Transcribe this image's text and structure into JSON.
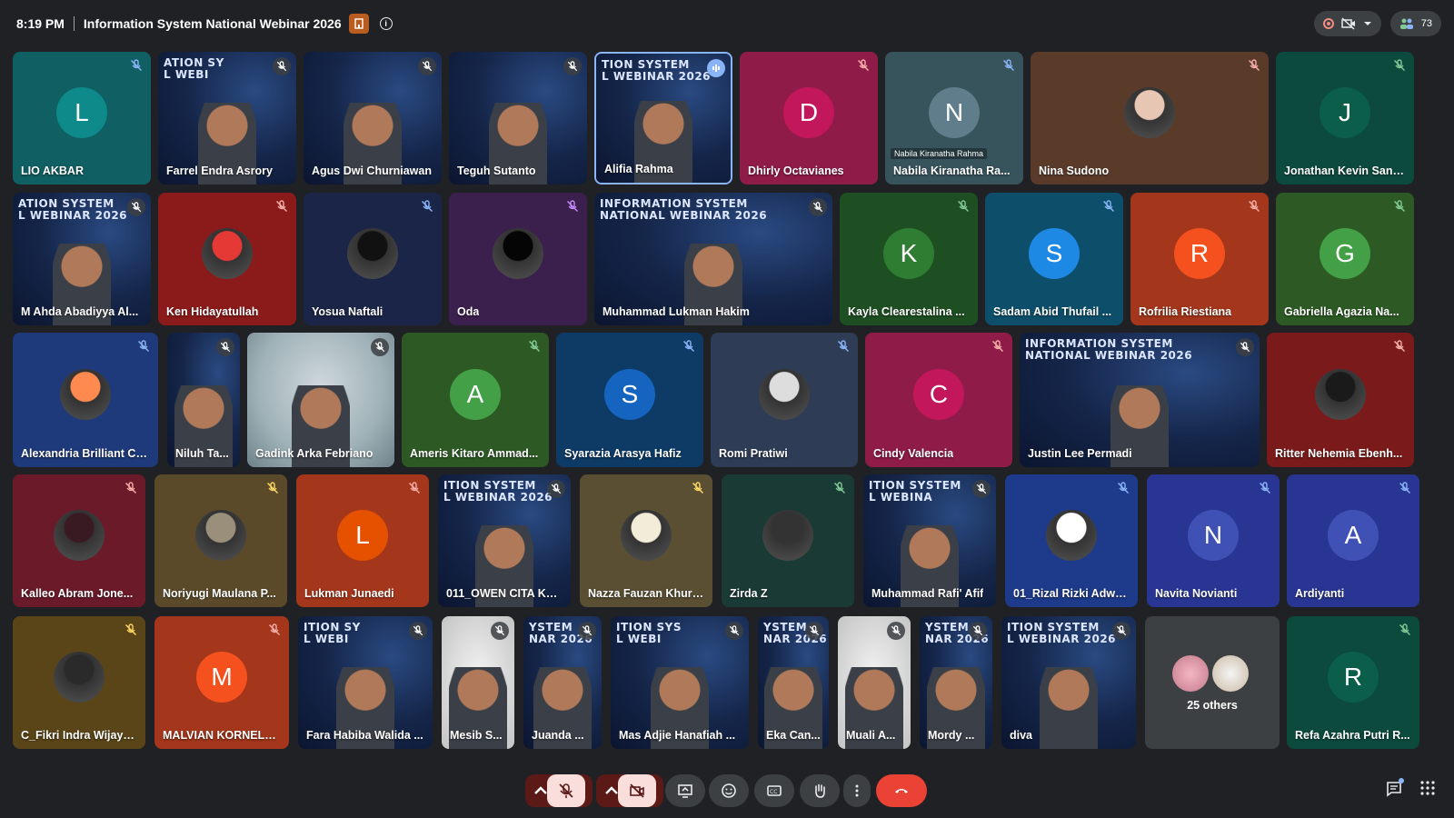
{
  "topbar": {
    "time": "8:19 PM",
    "title": "Information System National Webinar 2026",
    "participant_count": "73"
  },
  "colors": {
    "background": "#202124",
    "control_bg": "#3c4043",
    "end_call": "#ea4335",
    "speaking_border": "#8ab4f8"
  },
  "tiles": [
    {
      "name": "LIO AKBAR",
      "type": "avatar",
      "initial": "L",
      "avatar_color": "#0e8a8a",
      "bg": "#0f5f63",
      "mute": "muted",
      "mute_color": "#8ab4f8"
    },
    {
      "name": "Farrel Endra Asrory",
      "type": "video",
      "banner": "ATION SY\nL WEBI",
      "mute": "muted"
    },
    {
      "name": "Agus Dwi Churniawan",
      "type": "video",
      "banner": "",
      "mute": "muted"
    },
    {
      "name": "Teguh Sutanto",
      "type": "video",
      "banner": "",
      "mute": "muted"
    },
    {
      "name": "Alifia Rahma",
      "type": "video",
      "banner": "TION SYSTEM\nL WEBINAR 2026",
      "speaking": true,
      "mute": "speaking"
    },
    {
      "name": "Dhirly Octavianes",
      "type": "avatar",
      "initial": "D",
      "avatar_color": "#c2185b",
      "bg": "#8f1b48",
      "mute": "muted",
      "mute_color": "#f6aea9"
    },
    {
      "name": "Nabila Kiranatha Ra...",
      "type": "avatar",
      "initial": "N",
      "avatar_color": "#607d8b",
      "bg": "#37535c",
      "mute": "muted",
      "mute_color": "#8ab4f8",
      "sub": "Nabila Kiranatha Rahma"
    },
    {
      "name": "Nina Sudono",
      "type": "photo",
      "bg": "#5a3b2a",
      "photo_color": "#e8c6b4",
      "mute": "muted",
      "mute_color": "#f6aea9"
    },
    {
      "name": "Jonathan Kevin Sant...",
      "type": "avatar",
      "initial": "J",
      "avatar_color": "#0b5e4a",
      "bg": "#0d4a3e",
      "mute": "muted",
      "mute_color": "#81c995"
    },
    {
      "name": "M Ahda Abadiyya Al...",
      "type": "video",
      "banner": "ATION SYSTEM\nL WEBINAR 2026",
      "mute": "muted"
    },
    {
      "name": "Ken Hidayatullah",
      "type": "photo",
      "bg": "#8b1a1a",
      "photo_color": "#e53935",
      "mute": "muted",
      "mute_color": "#f6aea9"
    },
    {
      "name": "Yosua Naftali",
      "type": "photo",
      "bg": "#1a2547",
      "photo_color": "#111111",
      "mute": "muted",
      "mute_color": "#8ab4f8"
    },
    {
      "name": "Oda",
      "type": "photo",
      "bg": "#3b1f4d",
      "photo_color": "#050505",
      "mute": "muted",
      "mute_color": "#c58af9"
    },
    {
      "name": "Muhammad Lukman Hakim",
      "type": "video",
      "banner": "INFORMATION SYSTEM\nNATIONAL WEBINAR 2026",
      "mute": "muted"
    },
    {
      "name": "Kayla Clearestalina ...",
      "type": "avatar",
      "initial": "K",
      "avatar_color": "#2e7d32",
      "bg": "#1e4f22",
      "mute": "muted",
      "mute_color": "#81c995"
    },
    {
      "name": "Sadam Abid Thufail ...",
      "type": "avatar",
      "initial": "S",
      "avatar_color": "#1e88e5",
      "bg": "#0d4f6b",
      "mute": "muted",
      "mute_color": "#8ab4f8"
    },
    {
      "name": "Rofrilia Riestiana",
      "type": "avatar",
      "initial": "R",
      "avatar_color": "#f4511e",
      "bg": "#a3361b",
      "mute": "muted",
      "mute_color": "#f6aea9"
    },
    {
      "name": "Gabriella Agazia Na...",
      "type": "avatar",
      "initial": "G",
      "avatar_color": "#43a047",
      "bg": "#2d5a24",
      "mute": "muted",
      "mute_color": "#81c995"
    },
    {
      "name": "Alexandria Brilliant Ch...",
      "type": "photo",
      "bg": "#1f3a7a",
      "photo_color": "#ff8a50",
      "mute": "muted",
      "mute_color": "#8ab4f8"
    },
    {
      "name": "Niluh Ta...",
      "type": "video",
      "banner": "",
      "mute": "muted"
    },
    {
      "name": "Gadink Arka Febriano",
      "type": "video-light",
      "mute": "muted"
    },
    {
      "name": "Ameris Kitaro Ammad...",
      "type": "avatar",
      "initial": "A",
      "avatar_color": "#43a047",
      "bg": "#2d5a24",
      "mute": "muted",
      "mute_color": "#81c995"
    },
    {
      "name": "Syarazia Arasya Hafiz",
      "type": "avatar",
      "initial": "S",
      "avatar_color": "#1565c0",
      "bg": "#0d3b66",
      "mute": "muted",
      "mute_color": "#8ab4f8"
    },
    {
      "name": "Romi Pratiwi",
      "type": "photo",
      "bg": "#2e3c55",
      "photo_color": "#dddddd",
      "mute": "muted",
      "mute_color": "#8ab4f8"
    },
    {
      "name": "Cindy Valencia",
      "type": "avatar",
      "initial": "C",
      "avatar_color": "#c2185b",
      "bg": "#8f1b48",
      "mute": "muted",
      "mute_color": "#f6aea9"
    },
    {
      "name": "Justin Lee Permadi",
      "type": "video",
      "banner": "INFORMATION SYSTEM\nNATIONAL WEBINAR 2026",
      "mute": "muted"
    },
    {
      "name": "Ritter Nehemia Ebenh...",
      "type": "photo",
      "bg": "#7a1a1a",
      "photo_color": "#1a1a1a",
      "mute": "muted",
      "mute_color": "#f6aea9"
    },
    {
      "name": "Kalleo Abram Jone...",
      "type": "photo",
      "bg": "#6b1a2a",
      "photo_color": "#3a1a22",
      "mute": "muted",
      "mute_color": "#f6aea9"
    },
    {
      "name": "Noriyugi Maulana P...",
      "type": "photo",
      "bg": "#5a4a2a",
      "photo_color": "#9a8f7a",
      "mute": "muted",
      "mute_color": "#fdd663"
    },
    {
      "name": "Lukman Junaedi",
      "type": "avatar",
      "initial": "L",
      "avatar_color": "#e65100",
      "bg": "#a3361b",
      "mute": "muted",
      "mute_color": "#f6aea9"
    },
    {
      "name": "011_OWEN CITA KA...",
      "type": "video",
      "banner": "ITION SYSTEM\nL WEBINAR 2026",
      "mute": "muted"
    },
    {
      "name": "Nazza Fauzan Khuri...",
      "type": "photo",
      "bg": "#5a4f33",
      "photo_color": "#f3ecd8",
      "mute": "muted",
      "mute_color": "#fdd663"
    },
    {
      "name": "Zirda Z",
      "type": "photo",
      "bg": "#1a3a35",
      "photo_color": "#333333",
      "mute": "muted",
      "mute_color": "#81c995"
    },
    {
      "name": "Muhammad Rafi' Afif",
      "type": "video",
      "banner": "ITION SYSTEM\nL WEBINA",
      "mute": "muted"
    },
    {
      "name": "01_Rizal Rizki Adwit...",
      "type": "photo",
      "bg": "#1e3a8a",
      "photo_color": "#ffffff",
      "mute": "muted",
      "mute_color": "#8ab4f8"
    },
    {
      "name": "Navita Novianti",
      "type": "avatar",
      "initial": "N",
      "avatar_color": "#3f51b5",
      "bg": "#283593",
      "mute": "muted",
      "mute_color": "#8ab4f8"
    },
    {
      "name": "Ardiyanti",
      "type": "avatar",
      "initial": "A",
      "avatar_color": "#3f51b5",
      "bg": "#283593",
      "mute": "muted",
      "mute_color": "#8ab4f8"
    },
    {
      "name": "C_Fikri Indra Wijaya...",
      "type": "photo",
      "bg": "#5a4518",
      "photo_color": "#2a2a2a",
      "mute": "muted",
      "mute_color": "#fdd663"
    },
    {
      "name": "MALVIAN KORNELL...",
      "type": "avatar",
      "initial": "M",
      "avatar_color": "#f4511e",
      "bg": "#a3361b",
      "mute": "muted",
      "mute_color": "#f6aea9"
    },
    {
      "name": "Fara Habiba Walida ...",
      "type": "video",
      "banner": "ITION SY\nL WEBI",
      "mute": "muted"
    },
    {
      "name": "Mesib S...",
      "type": "video-white",
      "mute": "muted"
    },
    {
      "name": "Juanda ...",
      "type": "video",
      "banner": "YSTEM\nNAR 2026",
      "mute": "muted"
    },
    {
      "name": "Mas Adjie Hanafiah ...",
      "type": "video",
      "banner": "ITION SYS\nL WEBI",
      "mute": "muted"
    },
    {
      "name": "Eka Can...",
      "type": "video",
      "banner": "YSTEM\nNAR 2026",
      "mute": "muted"
    },
    {
      "name": "Muali A...",
      "type": "video-white",
      "mute": "muted"
    },
    {
      "name": "Mordy ...",
      "type": "video",
      "banner": "YSTEM\nNAR 2026",
      "mute": "muted"
    },
    {
      "name": "diva",
      "type": "video",
      "banner": "ITION SYSTEM\nL WEBINAR 2026",
      "mute": "muted"
    },
    {
      "name": "25 others",
      "type": "others",
      "bg": "#3c4043"
    },
    {
      "name": "Refa Azahra Putri R...",
      "type": "avatar",
      "initial": "R",
      "avatar_color": "#0b5e4a",
      "bg": "#0d4a3e",
      "mute": "muted",
      "mute_color": "#81c995"
    }
  ],
  "controls": {
    "mic_state": "muted",
    "camera_state": "off",
    "icons": [
      "chevron-up-icon",
      "mic-off-icon",
      "chevron-up-icon",
      "camera-off-icon",
      "present-icon",
      "emoji-icon",
      "captions-icon",
      "raise-hand-icon",
      "more-icon",
      "end-call-icon"
    ]
  },
  "bottom_right": {
    "icons": [
      "chat-icon",
      "apps-icon"
    ]
  }
}
